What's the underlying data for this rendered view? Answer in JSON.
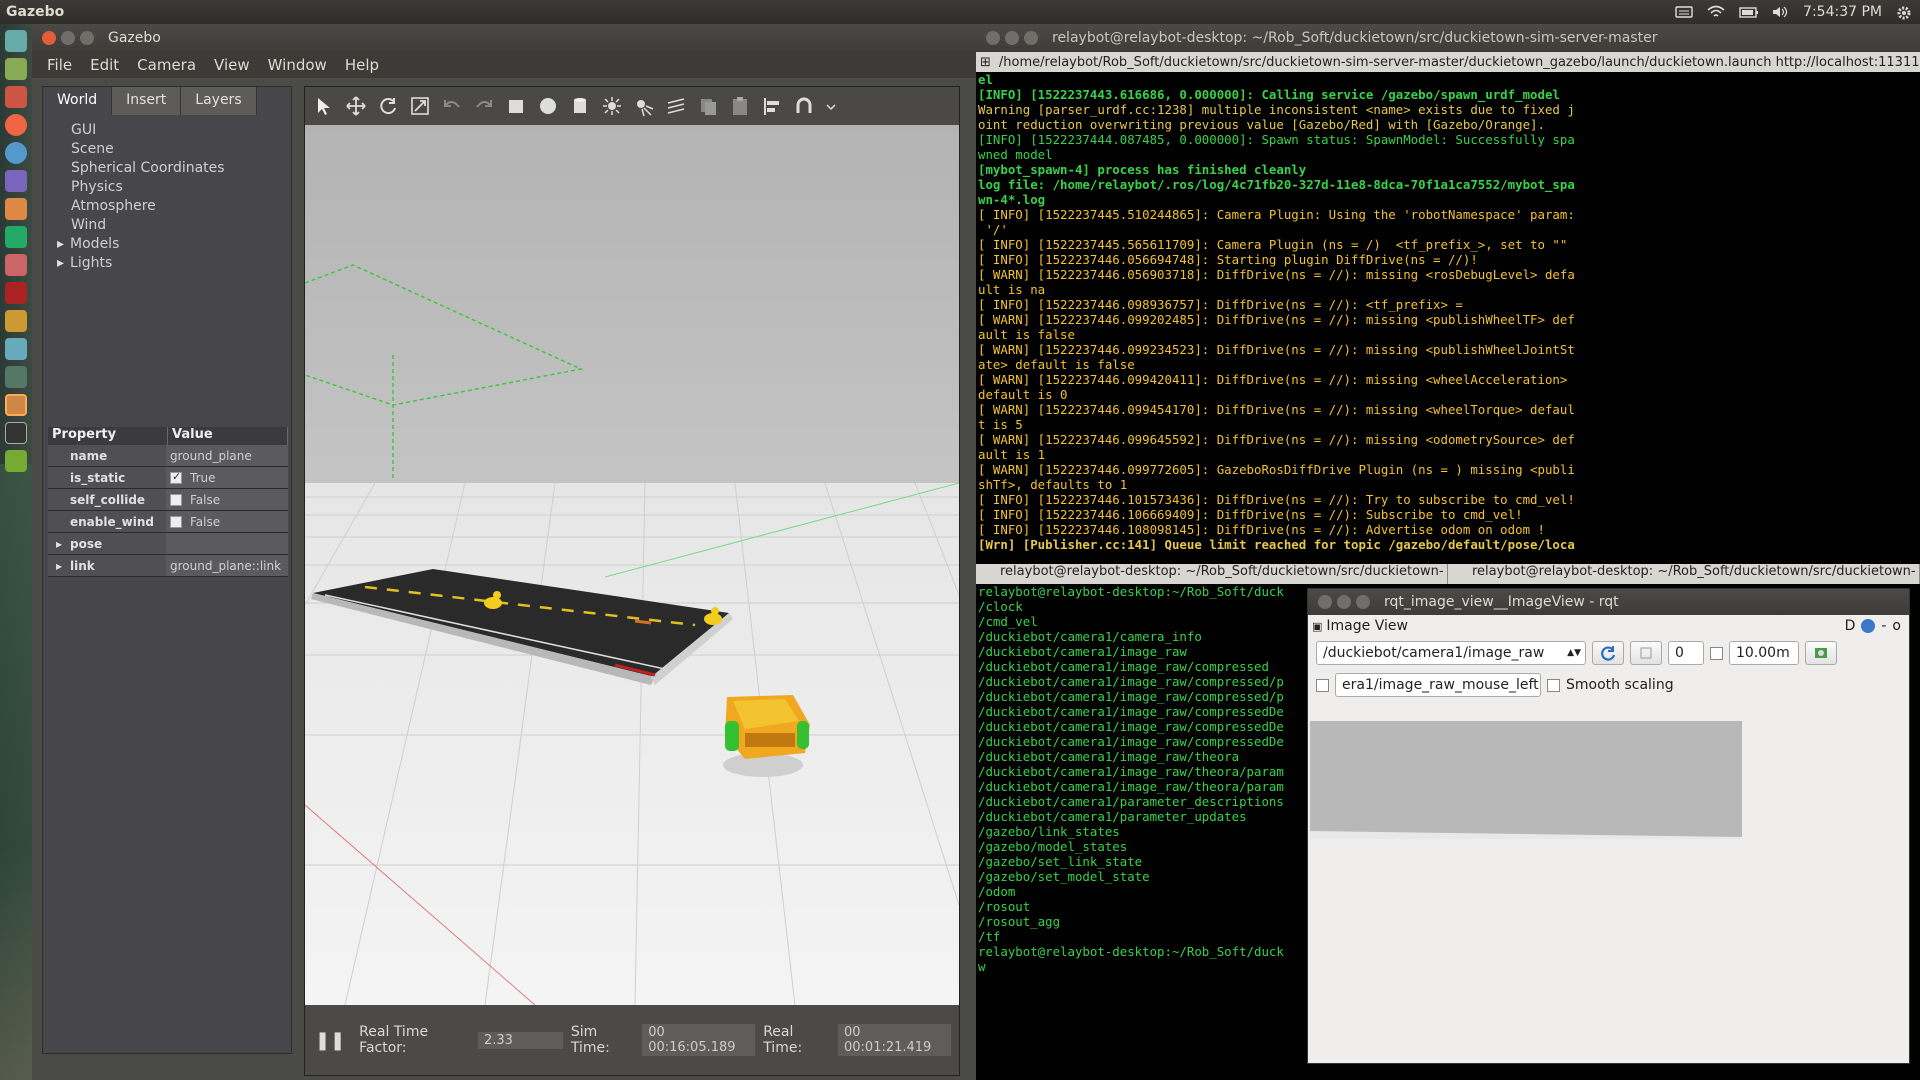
{
  "topbar": {
    "app_title": "Gazebo",
    "time": "7:54:37 PM"
  },
  "gazebo": {
    "window_title": "Gazebo",
    "menu": [
      "File",
      "Edit",
      "Camera",
      "View",
      "Window",
      "Help"
    ],
    "tabs": [
      "World",
      "Insert",
      "Layers"
    ],
    "tree": [
      "GUI",
      "Scene",
      "Spherical Coordinates",
      "Physics",
      "Atmosphere",
      "Wind",
      "Models",
      "Lights"
    ],
    "props_header": {
      "property": "Property",
      "value": "Value"
    },
    "props": [
      {
        "name": "name",
        "value": "ground_plane"
      },
      {
        "name": "is_static",
        "value": "True"
      },
      {
        "name": "self_collide",
        "value": "False"
      },
      {
        "name": "enable_wind",
        "value": "False"
      },
      {
        "name": "pose",
        "value": ""
      },
      {
        "name": "link",
        "value": "ground_plane::link"
      }
    ],
    "status": {
      "rtf_label": "Real Time Factor:",
      "rtf_value": "2.33",
      "sim_label": "Sim Time:",
      "sim_value": "00 00:16:05.189",
      "real_label": "Real Time:",
      "real_value": "00 00:01:21.419"
    }
  },
  "term_top": {
    "title": "relaybot@relaybot-desktop: ~/Rob_Soft/duckietown/src/duckietown-sim-server-master",
    "tab_path": "/home/relaybot/Rob_Soft/duckietown/src/duckietown-sim-server-master/duckietown_gazebo/launch/duckietown.launch http://localhost:11311",
    "lines": [
      {
        "t": "el",
        "c": "c-green c-bold"
      },
      {
        "t": "[INFO] [1522237443.616686, 0.000000]: Calling service /gazebo/spawn_urdf_model",
        "c": "c-green c-bold"
      },
      {
        "t": "Warning [parser_urdf.cc:1238] multiple inconsistent <name> exists due to fixed j",
        "c": "c-yellow"
      },
      {
        "t": "oint reduction overwriting previous value [Gazebo/Red] with [Gazebo/Orange].",
        "c": "c-yellow"
      },
      {
        "t": "[INFO] [1522237444.087485, 0.000000]: Spawn status: SpawnModel: Successfully spa",
        "c": "c-green"
      },
      {
        "t": "wned model",
        "c": "c-green"
      },
      {
        "t": "[mybot_spawn-4] process has finished cleanly",
        "c": "c-green c-bold"
      },
      {
        "t": "log file: /home/relaybot/.ros/log/4c71fb20-327d-11e8-8dca-70f1a1ca7552/mybot_spa",
        "c": "c-green c-bold"
      },
      {
        "t": "wn-4*.log",
        "c": "c-green c-bold"
      },
      {
        "t": "[ INFO] [1522237445.510244865]: Camera Plugin: Using the 'robotNamespace' param:",
        "c": "c-warn"
      },
      {
        "t": " '/'",
        "c": "c-warn"
      },
      {
        "t": "[ INFO] [1522237445.565611709]: Camera Plugin (ns = /)  <tf_prefix_>, set to \"\"",
        "c": "c-warn"
      },
      {
        "t": "[ INFO] [1522237446.056694748]: Starting plugin DiffDrive(ns = //)!",
        "c": "c-warn"
      },
      {
        "t": "[ WARN] [1522237446.056903718]: DiffDrive(ns = //): missing <rosDebugLevel> defa",
        "c": "c-warn"
      },
      {
        "t": "ult is na",
        "c": "c-warn"
      },
      {
        "t": "[ INFO] [1522237446.098936757]: DiffDrive(ns = //): <tf_prefix> =",
        "c": "c-warn"
      },
      {
        "t": "[ WARN] [1522237446.099202485]: DiffDrive(ns = //): missing <publishWheelTF> def",
        "c": "c-warn"
      },
      {
        "t": "ault is false",
        "c": "c-warn"
      },
      {
        "t": "[ WARN] [1522237446.099234523]: DiffDrive(ns = //): missing <publishWheelJointSt",
        "c": "c-warn"
      },
      {
        "t": "ate> default is false",
        "c": "c-warn"
      },
      {
        "t": "[ WARN] [1522237446.099420411]: DiffDrive(ns = //): missing <wheelAcceleration>",
        "c": "c-warn"
      },
      {
        "t": "default is 0",
        "c": "c-warn"
      },
      {
        "t": "[ WARN] [1522237446.099454170]: DiffDrive(ns = //): missing <wheelTorque> defaul",
        "c": "c-warn"
      },
      {
        "t": "t is 5",
        "c": "c-warn"
      },
      {
        "t": "[ WARN] [1522237446.099645592]: DiffDrive(ns = //): missing <odometrySource> def",
        "c": "c-warn"
      },
      {
        "t": "ault is 1",
        "c": "c-warn"
      },
      {
        "t": "[ WARN] [1522237446.099772605]: GazeboRosDiffDrive Plugin (ns = ) missing <publi",
        "c": "c-warn"
      },
      {
        "t": "shTf>, defaults to 1",
        "c": "c-warn"
      },
      {
        "t": "[ INFO] [1522237446.101573436]: DiffDrive(ns = //): Try to subscribe to cmd_vel!",
        "c": "c-warn"
      },
      {
        "t": "[ INFO] [1522237446.106669409]: DiffDrive(ns = //): Subscribe to cmd_vel!",
        "c": "c-warn"
      },
      {
        "t": "[ INFO] [1522237446.108098145]: DiffDrive(ns = //): Advertise odom on odom !",
        "c": "c-warn"
      },
      {
        "t": "[Wrn] [Publisher.cc:141] Queue limit reached for topic /gazebo/default/pose/loca",
        "c": "c-yellow c-bold"
      }
    ]
  },
  "term_bot": {
    "tab1": "relaybot@relaybot-desktop: ~/Rob_Soft/duckietown/src/duckietown-",
    "tab2": "relaybot@relaybot-desktop: ~/Rob_Soft/duckietown/src/duckietown-",
    "lines": [
      "relaybot@relaybot-desktop:~/Rob_Soft/duck",
      "/clock",
      "/cmd_vel",
      "/duckiebot/camera1/camera_info",
      "/duckiebot/camera1/image_raw",
      "/duckiebot/camera1/image_raw/compressed",
      "/duckiebot/camera1/image_raw/compressed/p",
      "/duckiebot/camera1/image_raw/compressed/p",
      "/duckiebot/camera1/image_raw/compressedDe",
      "/duckiebot/camera1/image_raw/compressedDe",
      "/duckiebot/camera1/image_raw/compressedDe",
      "/duckiebot/camera1/image_raw/theora",
      "/duckiebot/camera1/image_raw/theora/param",
      "/duckiebot/camera1/image_raw/theora/param",
      "/duckiebot/camera1/parameter_descriptions",
      "/duckiebot/camera1/parameter_updates",
      "/gazebo/link_states",
      "/gazebo/model_states",
      "/gazebo/set_link_state",
      "/gazebo/set_model_state",
      "/odom",
      "/rosout",
      "/rosout_agg",
      "/tf",
      "relaybot@relaybot-desktop:~/Rob_Soft/duck",
      "w"
    ]
  },
  "rqt": {
    "title": "rqt_image_view__ImageView - rqt",
    "panel_title": "Image View",
    "panel_buttons": "D",
    "topic": "/duckiebot/camera1/image_raw",
    "spin_value": "0",
    "duration": "10.00m",
    "mouse_topic": "era1/image_raw_mouse_left",
    "smooth_label": "Smooth scaling"
  }
}
